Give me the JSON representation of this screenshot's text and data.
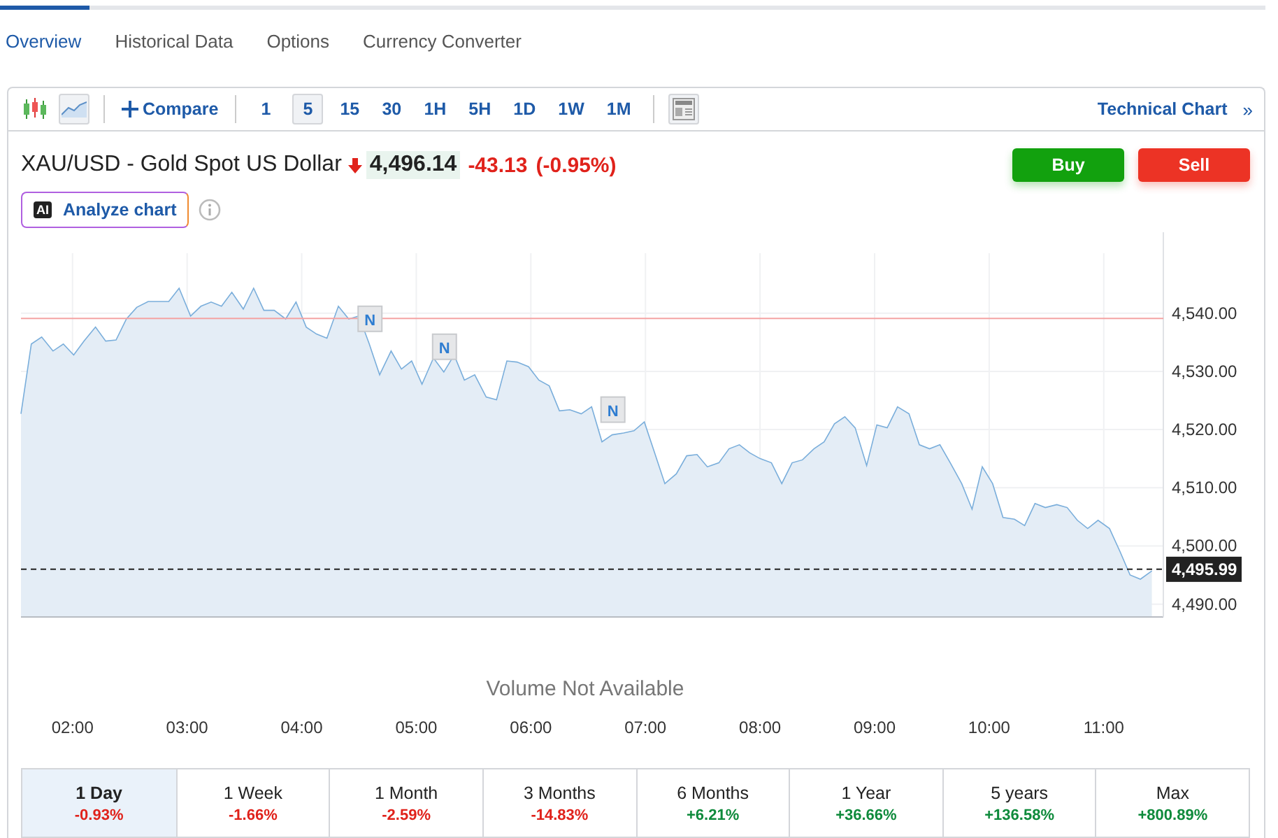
{
  "tabs": [
    {
      "label": "Overview",
      "selected": true
    },
    {
      "label": "Historical Data",
      "selected": false
    },
    {
      "label": "Options",
      "selected": false
    },
    {
      "label": "Currency Converter",
      "selected": false
    }
  ],
  "toolbar": {
    "chart_types": [
      {
        "kind": "candles",
        "selected": false
      },
      {
        "kind": "area",
        "selected": true
      }
    ],
    "compare": "Compare",
    "intervals": [
      {
        "label": "1",
        "selected": false
      },
      {
        "label": "5",
        "selected": true
      },
      {
        "label": "15",
        "selected": false
      },
      {
        "label": "30",
        "selected": false
      },
      {
        "label": "1H",
        "selected": false
      },
      {
        "label": "5H",
        "selected": false
      },
      {
        "label": "1D",
        "selected": false
      },
      {
        "label": "1W",
        "selected": false
      },
      {
        "label": "1M",
        "selected": false
      }
    ],
    "technical_chart": "Technical Chart",
    "technical_chart_arrow": "»"
  },
  "quote": {
    "title": "XAU/USD - Gold Spot US Dollar",
    "negative": true,
    "price": "4,496.14",
    "change": "-43.13",
    "change_percent": "(-0.95%)"
  },
  "buttons": [
    {
      "kind": "buy",
      "label": "Buy"
    },
    {
      "kind": "sell",
      "label": "Sell"
    }
  ],
  "analyze": {
    "badge": "AI",
    "label": "Analyze chart"
  },
  "chart": {
    "chart_data": {
      "type": "area",
      "grid": true,
      "xlim": [
        1.55,
        11.52
      ],
      "ylim": [
        4487.8,
        4550.3
      ],
      "x": [
        1.55,
        1.64,
        1.73,
        1.83,
        1.92,
        2.01,
        2.1,
        2.2,
        2.29,
        2.38,
        2.47,
        2.56,
        2.66,
        2.75,
        2.84,
        2.93,
        3.03,
        3.12,
        3.21,
        3.3,
        3.39,
        3.49,
        3.58,
        3.67,
        3.76,
        3.86,
        3.95,
        4.04,
        4.13,
        4.22,
        4.32,
        4.41,
        4.5,
        4.59,
        4.68,
        4.78,
        4.87,
        4.96,
        5.05,
        5.15,
        5.24,
        5.33,
        5.42,
        5.51,
        5.61,
        5.7,
        5.79,
        5.88,
        5.98,
        6.07,
        6.16,
        6.25,
        6.34,
        6.44,
        6.53,
        6.62,
        6.71,
        6.81,
        6.9,
        6.99,
        7.08,
        7.17,
        7.27,
        7.36,
        7.45,
        7.54,
        7.64,
        7.73,
        7.82,
        7.91,
        8.0,
        8.1,
        8.19,
        8.28,
        8.37,
        8.47,
        8.56,
        8.65,
        8.74,
        8.83,
        8.93,
        9.02,
        9.11,
        9.2,
        9.3,
        9.39,
        9.48,
        9.57,
        9.66,
        9.76,
        9.85,
        9.94,
        10.03,
        10.12,
        10.22,
        10.31,
        10.4,
        10.49,
        10.59,
        10.68,
        10.77,
        10.86,
        10.95,
        11.05,
        11.14,
        11.23,
        11.32,
        11.42
      ],
      "xticks": [
        {
          "value": 2,
          "label": "02:00"
        },
        {
          "value": 3,
          "label": "03:00"
        },
        {
          "value": 4,
          "label": "04:00"
        },
        {
          "value": 5,
          "label": "05:00"
        },
        {
          "value": 6,
          "label": "06:00"
        },
        {
          "value": 7,
          "label": "07:00"
        },
        {
          "value": 8,
          "label": "08:00"
        },
        {
          "value": 9,
          "label": "09:00"
        },
        {
          "value": 10,
          "label": "10:00"
        },
        {
          "value": 11,
          "label": "11:00"
        }
      ],
      "yticks": [
        {
          "value": 4490,
          "label": "4,490.00"
        },
        {
          "value": 4500,
          "label": "4,500.00"
        },
        {
          "value": 4510,
          "label": "4,510.00"
        },
        {
          "value": 4520,
          "label": "4,520.00"
        },
        {
          "value": 4530,
          "label": "4,530.00"
        },
        {
          "value": 4540,
          "label": "4,540.00"
        }
      ],
      "series": [
        {
          "color": "#7aaedb",
          "values": [
            4522.7,
            4534.7,
            4535.9,
            4533.5,
            4534.7,
            4532.8,
            4535.2,
            4537.6,
            4535.2,
            4535.4,
            4539.0,
            4541.0,
            4542.0,
            4542.0,
            4542.0,
            4544.3,
            4539.5,
            4541.2,
            4541.9,
            4541.2,
            4543.6,
            4540.7,
            4544.3,
            4540.5,
            4540.5,
            4539.0,
            4541.9,
            4537.6,
            4536.4,
            4535.7,
            4541.2,
            4539.0,
            4539.5,
            4534.7,
            4529.4,
            4533.5,
            4530.4,
            4531.8,
            4527.8,
            4532.3,
            4529.9,
            4532.8,
            4528.5,
            4529.4,
            4525.6,
            4525.1,
            4531.8,
            4531.6,
            4530.8,
            4528.5,
            4527.5,
            4523.2,
            4523.4,
            4522.7,
            4523.9,
            4517.9,
            4519.1,
            4519.4,
            4519.8,
            4521.3,
            4516.0,
            4510.7,
            4512.4,
            4515.5,
            4515.7,
            4513.6,
            4514.3,
            4516.7,
            4517.4,
            4516.0,
            4515.0,
            4514.3,
            4510.7,
            4514.3,
            4514.8,
            4516.7,
            4517.9,
            4521.0,
            4522.2,
            4520.3,
            4513.8,
            4520.8,
            4520.3,
            4523.9,
            4522.7,
            4517.4,
            4516.7,
            4517.4,
            4514.3,
            4510.7,
            4506.3,
            4513.6,
            4510.7,
            4504.9,
            4504.6,
            4503.5,
            4507.3,
            4506.6,
            4507.1,
            4506.6,
            4504.4,
            4503.0,
            4504.4,
            4503.0,
            4499.1,
            4495.0,
            4494.3,
            4495.7
          ]
        }
      ],
      "ref_lines": [
        {
          "axis": "y",
          "value": 4539.1,
          "color": "#f4a3a3"
        },
        {
          "axis": "y",
          "value": 4495.99,
          "color": "#222222",
          "label": "4,495.99"
        }
      ],
      "annotations": [
        {
          "text": "N",
          "x": 4.59,
          "y": 4534.7
        },
        {
          "text": "N",
          "x": 5.24,
          "y": 4529.9
        },
        {
          "text": "N",
          "x": 6.71,
          "y": 4519.1
        }
      ]
    },
    "volume_note": "Volume Not Available"
  },
  "periods": [
    {
      "label": "1 Day",
      "change": "-0.93%",
      "negative": true,
      "selected": true
    },
    {
      "label": "1 Week",
      "change": "-1.66%",
      "negative": true,
      "selected": false
    },
    {
      "label": "1 Month",
      "change": "-2.59%",
      "negative": true,
      "selected": false
    },
    {
      "label": "3 Months",
      "change": "-14.83%",
      "negative": true,
      "selected": false
    },
    {
      "label": "6 Months",
      "change": "+6.21%",
      "negative": false,
      "selected": false
    },
    {
      "label": "1 Year",
      "change": "+36.66%",
      "negative": false,
      "selected": false
    },
    {
      "label": "5 years",
      "change": "+136.58%",
      "negative": false,
      "selected": false
    },
    {
      "label": "Max",
      "change": "+800.89%",
      "negative": false,
      "selected": false
    }
  ]
}
